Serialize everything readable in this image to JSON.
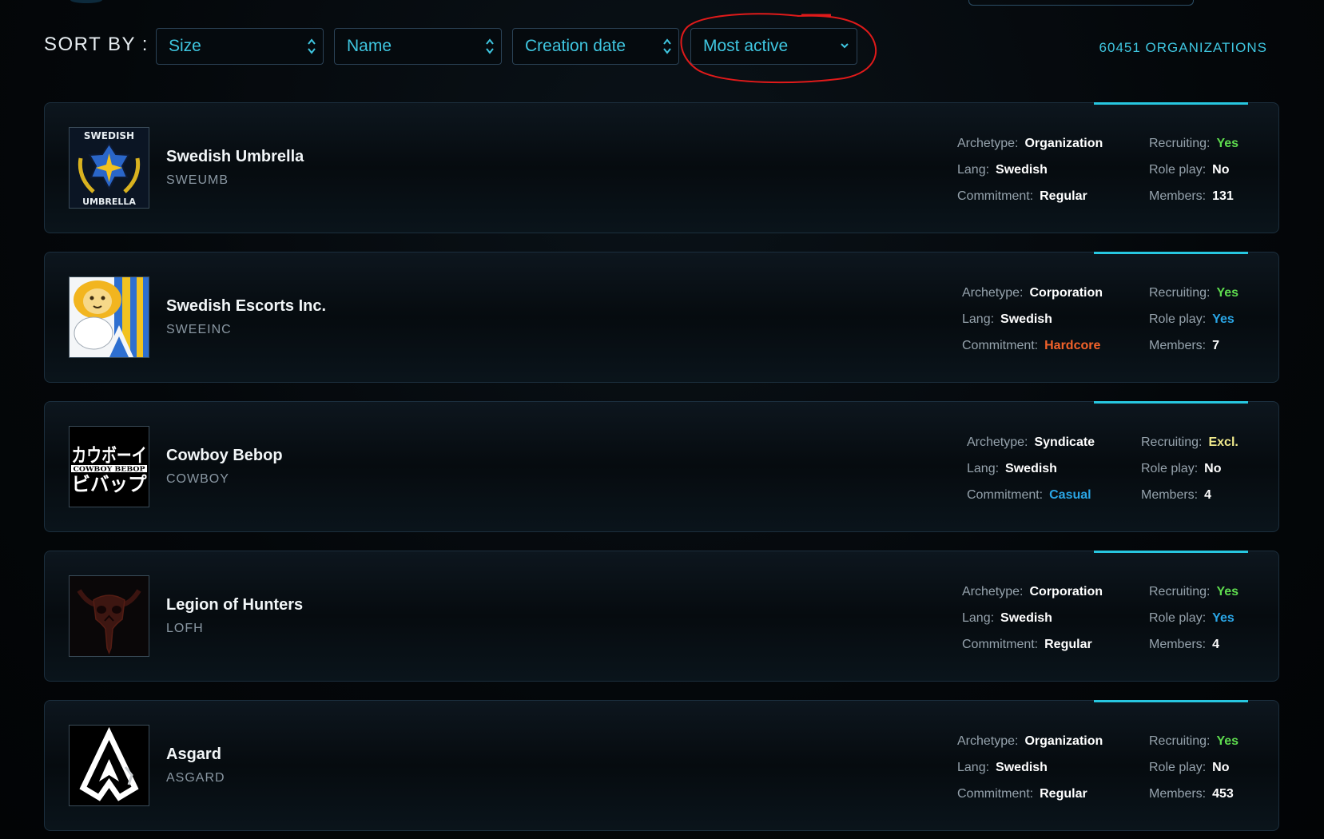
{
  "sort": {
    "label": "SORT BY :",
    "options": [
      {
        "label": "Size",
        "control": "updown"
      },
      {
        "label": "Name",
        "control": "updown"
      },
      {
        "label": "Creation date",
        "control": "updown"
      },
      {
        "label": "Most active",
        "control": "dropdown"
      }
    ]
  },
  "org_count": "60451 ORGANIZATIONS",
  "colors": {
    "accent": "#27c7e0",
    "select_text": "#3fc6e0",
    "annotation": "#e01a1a",
    "green": "#5edb4e",
    "blue": "#2aa6e6",
    "orange": "#f2622a",
    "yellow": "#f1ea8c"
  },
  "orgs": [
    {
      "name": "Swedish Umbrella",
      "tag": "SWEUMB",
      "logo": "swedish-umbrella-logo",
      "logo_text_top": "SWEDISH",
      "logo_text_bottom": "UMBRELLA",
      "archetype_label": "Archetype:",
      "archetype": "Organization",
      "lang_label": "Lang:",
      "lang": "Swedish",
      "commitment_label": "Commitment:",
      "commitment": "Regular",
      "commitment_color": "",
      "recruiting_label": "Recruiting:",
      "recruiting": "Yes",
      "recruiting_color": "green",
      "roleplay_label": "Role play:",
      "roleplay": "No",
      "roleplay_color": "",
      "members_label": "Members:",
      "members": "131"
    },
    {
      "name": "Swedish Escorts Inc.",
      "tag": "SWEEINC",
      "logo": "lion-flag-logo",
      "archetype_label": "Archetype:",
      "archetype": "Corporation",
      "lang_label": "Lang:",
      "lang": "Swedish",
      "commitment_label": "Commitment:",
      "commitment": "Hardcore",
      "commitment_color": "orange",
      "recruiting_label": "Recruiting:",
      "recruiting": "Yes",
      "recruiting_color": "green",
      "roleplay_label": "Role play:",
      "roleplay": "Yes",
      "roleplay_color": "blue",
      "members_label": "Members:",
      "members": "7"
    },
    {
      "name": "Cowboy Bebop",
      "tag": "COWBOY",
      "logo": "cowboy-bebop-logo",
      "logo_text_top": "カウボーイ",
      "logo_text_mid": "COWBOY BEBOP",
      "logo_text_bottom": "ビバップ",
      "archetype_label": "Archetype:",
      "archetype": "Syndicate",
      "lang_label": "Lang:",
      "lang": "Swedish",
      "commitment_label": "Commitment:",
      "commitment": "Casual",
      "commitment_color": "blue",
      "recruiting_label": "Recruiting:",
      "recruiting": "Excl.",
      "recruiting_color": "yellow",
      "roleplay_label": "Role play:",
      "roleplay": "No",
      "roleplay_color": "",
      "members_label": "Members:",
      "members": "4"
    },
    {
      "name": "Legion of Hunters",
      "tag": "LOFH",
      "logo": "hunter-skull-logo",
      "archetype_label": "Archetype:",
      "archetype": "Corporation",
      "lang_label": "Lang:",
      "lang": "Swedish",
      "commitment_label": "Commitment:",
      "commitment": "Regular",
      "commitment_color": "",
      "recruiting_label": "Recruiting:",
      "recruiting": "Yes",
      "recruiting_color": "green",
      "roleplay_label": "Role play:",
      "roleplay": "Yes",
      "roleplay_color": "blue",
      "members_label": "Members:",
      "members": "4"
    },
    {
      "name": "Asgard",
      "tag": "ASGARD",
      "logo": "asgard-logo",
      "archetype_label": "Archetype:",
      "archetype": "Organization",
      "lang_label": "Lang:",
      "lang": "Swedish",
      "commitment_label": "Commitment:",
      "commitment": "Regular",
      "commitment_color": "",
      "recruiting_label": "Recruiting:",
      "recruiting": "Yes",
      "recruiting_color": "green",
      "roleplay_label": "Role play:",
      "roleplay": "No",
      "roleplay_color": "",
      "members_label": "Members:",
      "members": "453"
    }
  ]
}
